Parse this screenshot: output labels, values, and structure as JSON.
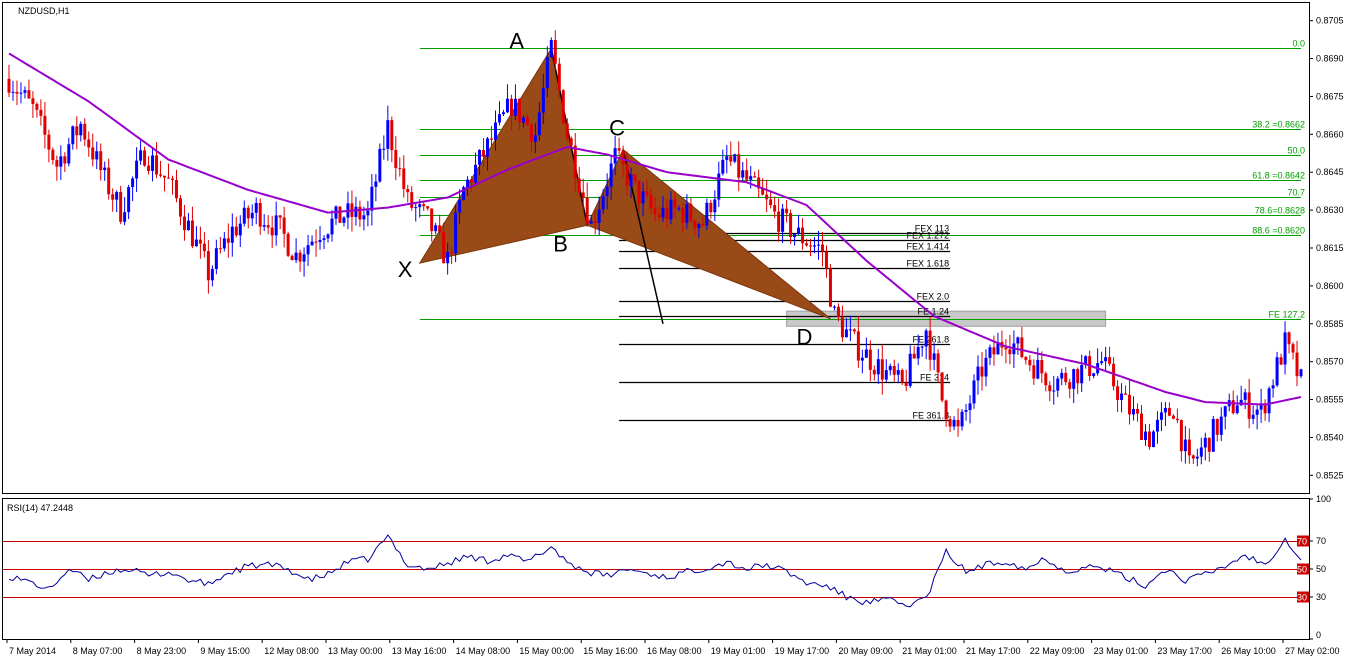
{
  "symbol_label": "NZDUSD,H1",
  "rsi_label": "RSI(14) 47.2448",
  "colors": {
    "bull": "#0000ff",
    "bear": "#e00000",
    "ma": "#9900cc",
    "pattern": "#9a4a17",
    "fib": "#00a000",
    "rsi": "#00009a",
    "rsi_levels": "#cc0000",
    "zone": "#c8c8c8"
  },
  "chart_data": [
    {
      "type": "candlestick",
      "title": "NZDUSD,H1",
      "ylim": [
        0.8518,
        0.8712
      ],
      "y_ticks": [
        "0.8705",
        "0.8690",
        "0.8675",
        "0.8660",
        "0.8645",
        "0.8630",
        "0.8615",
        "0.8600",
        "0.8585",
        "0.8570",
        "0.8555",
        "0.8540",
        "0.8525"
      ],
      "x_labels": [
        "7 May 2014",
        "8 May 07:00",
        "8 May 23:00",
        "9 May 15:00",
        "12 May 08:00",
        "13 May 00:00",
        "13 May 16:00",
        "14 May 08:00",
        "15 May 00:00",
        "15 May 16:00",
        "16 May 08:00",
        "19 May 01:00",
        "19 May 17:00",
        "20 May 09:00",
        "21 May 01:00",
        "21 May 17:00",
        "22 May 09:00",
        "23 May 01:00",
        "23 May 17:00",
        "26 May 10:00",
        "27 May 02:00"
      ],
      "price_anchors": [
        [
          0,
          0.8682
        ],
        [
          6,
          0.867
        ],
        [
          12,
          0.8648
        ],
        [
          18,
          0.8664
        ],
        [
          24,
          0.8642
        ],
        [
          28,
          0.863
        ],
        [
          34,
          0.8653
        ],
        [
          40,
          0.8641
        ],
        [
          46,
          0.862
        ],
        [
          50,
          0.8605
        ],
        [
          56,
          0.8622
        ],
        [
          62,
          0.863
        ],
        [
          68,
          0.8622
        ],
        [
          72,
          0.8612
        ],
        [
          78,
          0.8622
        ],
        [
          84,
          0.8628
        ],
        [
          90,
          0.8628
        ],
        [
          95,
          0.8663
        ],
        [
          100,
          0.8633
        ],
        [
          105,
          0.8626
        ],
        [
          110,
          0.861
        ],
        [
          114,
          0.8638
        ],
        [
          120,
          0.8655
        ],
        [
          126,
          0.8672
        ],
        [
          132,
          0.866
        ],
        [
          136,
          0.8694
        ],
        [
          140,
          0.866
        ],
        [
          146,
          0.8624
        ],
        [
          152,
          0.8651
        ],
        [
          157,
          0.8638
        ],
        [
          162,
          0.8628
        ],
        [
          168,
          0.863
        ],
        [
          174,
          0.8625
        ],
        [
          180,
          0.865
        ],
        [
          186,
          0.864
        ],
        [
          192,
          0.8628
        ],
        [
          198,
          0.862
        ],
        [
          204,
          0.8614
        ],
        [
          207,
          0.8588
        ],
        [
          212,
          0.8577
        ],
        [
          218,
          0.8568
        ],
        [
          224,
          0.856
        ],
        [
          230,
          0.8583
        ],
        [
          234,
          0.8555
        ],
        [
          238,
          0.8542
        ],
        [
          244,
          0.8567
        ],
        [
          250,
          0.858
        ],
        [
          256,
          0.857
        ],
        [
          262,
          0.8562
        ],
        [
          268,
          0.8566
        ],
        [
          274,
          0.857
        ],
        [
          280,
          0.8553
        ],
        [
          286,
          0.854
        ],
        [
          292,
          0.8552
        ],
        [
          296,
          0.8528
        ],
        [
          302,
          0.8542
        ],
        [
          308,
          0.8555
        ],
        [
          314,
          0.855
        ],
        [
          320,
          0.8577
        ],
        [
          324,
          0.8562
        ]
      ],
      "ma_anchors": [
        [
          0,
          0.8692
        ],
        [
          20,
          0.8673
        ],
        [
          40,
          0.865
        ],
        [
          60,
          0.8638
        ],
        [
          80,
          0.8629
        ],
        [
          95,
          0.8631
        ],
        [
          110,
          0.8635
        ],
        [
          125,
          0.8646
        ],
        [
          140,
          0.8655
        ],
        [
          150,
          0.8652
        ],
        [
          165,
          0.8645
        ],
        [
          185,
          0.8641
        ],
        [
          200,
          0.8632
        ],
        [
          215,
          0.861
        ],
        [
          232,
          0.8588
        ],
        [
          250,
          0.8576
        ],
        [
          270,
          0.8569
        ],
        [
          290,
          0.8558
        ],
        [
          300,
          0.8554
        ],
        [
          315,
          0.8553
        ],
        [
          324,
          0.8556
        ]
      ],
      "pattern": {
        "points": [
          {
            "name": "X",
            "index": 103,
            "price": 0.8609
          },
          {
            "name": "A",
            "index": 136,
            "price": 0.8694
          },
          {
            "name": "B",
            "index": 145,
            "price": 0.8624
          },
          {
            "name": "C",
            "index": 154,
            "price": 0.8654
          },
          {
            "name": "D",
            "index": 206,
            "price": 0.8587
          }
        ],
        "cd_projection_end": {
          "index": 164,
          "price": 0.8585
        },
        "ab_line_end": {
          "index": 145,
          "price": 0.8624
        }
      },
      "fib_green": {
        "start_index": 103,
        "end_index": 324,
        "levels": [
          {
            "label": "0.0",
            "price": 0.8694
          },
          {
            "label": "38.2 =0.8662",
            "price": 0.8662
          },
          {
            "label": "50.0",
            "price": 0.8652
          },
          {
            "label": "61.8 =0.8642",
            "price": 0.8642
          },
          {
            "label": "70.7",
            "price": 0.8635
          },
          {
            "label": "78.6=0.8628",
            "price": 0.8628
          },
          {
            "label": "88.6 =0.8620",
            "price": 0.862
          },
          {
            "label": "FE 127.2",
            "price": 0.8587
          }
        ]
      },
      "fib_black": {
        "start_index": 153,
        "end_index": 236,
        "levels": [
          {
            "label": "FEX 113",
            "price": 0.8621
          },
          {
            "label": "FEX 1.272",
            "price": 0.8618
          },
          {
            "label": "FEX 1.414",
            "price": 0.8614
          },
          {
            "label": "FEX 1.618",
            "price": 0.8607
          },
          {
            "label": "FEX 2.0",
            "price": 0.8594
          },
          {
            "label": "FE 1.24",
            "price": 0.8588
          },
          {
            "label": "FE 261.8",
            "price": 0.8577
          },
          {
            "label": "FE 314",
            "price": 0.8562
          },
          {
            "label": "FE 361.8",
            "price": 0.8547
          }
        ]
      },
      "zone": {
        "start_index": 195,
        "end_index": 275,
        "price_high": 0.859,
        "price_low": 0.8584
      }
    },
    {
      "type": "line",
      "title": "RSI(14) 47.2448",
      "ylim": [
        0,
        100
      ],
      "y_ticks": [
        "100",
        "70",
        "50",
        "30",
        "0"
      ],
      "levels": [
        70,
        50,
        30
      ],
      "level_labels": [
        "70",
        "50",
        "30"
      ],
      "anchors": [
        [
          0,
          45
        ],
        [
          6,
          40
        ],
        [
          10,
          35
        ],
        [
          15,
          50
        ],
        [
          20,
          42
        ],
        [
          25,
          48
        ],
        [
          30,
          50
        ],
        [
          35,
          45
        ],
        [
          40,
          48
        ],
        [
          45,
          42
        ],
        [
          50,
          39
        ],
        [
          55,
          47
        ],
        [
          60,
          52
        ],
        [
          65,
          53
        ],
        [
          70,
          50
        ],
        [
          75,
          42
        ],
        [
          80,
          46
        ],
        [
          85,
          55
        ],
        [
          90,
          57
        ],
        [
          95,
          73
        ],
        [
          100,
          53
        ],
        [
          105,
          50
        ],
        [
          110,
          54
        ],
        [
          115,
          59
        ],
        [
          120,
          56
        ],
        [
          125,
          60
        ],
        [
          130,
          55
        ],
        [
          136,
          66
        ],
        [
          140,
          55
        ],
        [
          145,
          48
        ],
        [
          150,
          45
        ],
        [
          155,
          50
        ],
        [
          160,
          47
        ],
        [
          165,
          44
        ],
        [
          170,
          48
        ],
        [
          175,
          51
        ],
        [
          180,
          55
        ],
        [
          185,
          50
        ],
        [
          190,
          53
        ],
        [
          195,
          48
        ],
        [
          200,
          40
        ],
        [
          205,
          38
        ],
        [
          210,
          30
        ],
        [
          215,
          26
        ],
        [
          220,
          28
        ],
        [
          225,
          24
        ],
        [
          230,
          29
        ],
        [
          235,
          62
        ],
        [
          240,
          48
        ],
        [
          245,
          53
        ],
        [
          250,
          56
        ],
        [
          255,
          50
        ],
        [
          260,
          58
        ],
        [
          265,
          48
        ],
        [
          270,
          52
        ],
        [
          275,
          50
        ],
        [
          280,
          44
        ],
        [
          285,
          38
        ],
        [
          290,
          50
        ],
        [
          295,
          42
        ],
        [
          300,
          46
        ],
        [
          305,
          52
        ],
        [
          310,
          60
        ],
        [
          315,
          53
        ],
        [
          320,
          72
        ],
        [
          324,
          57
        ]
      ]
    }
  ]
}
